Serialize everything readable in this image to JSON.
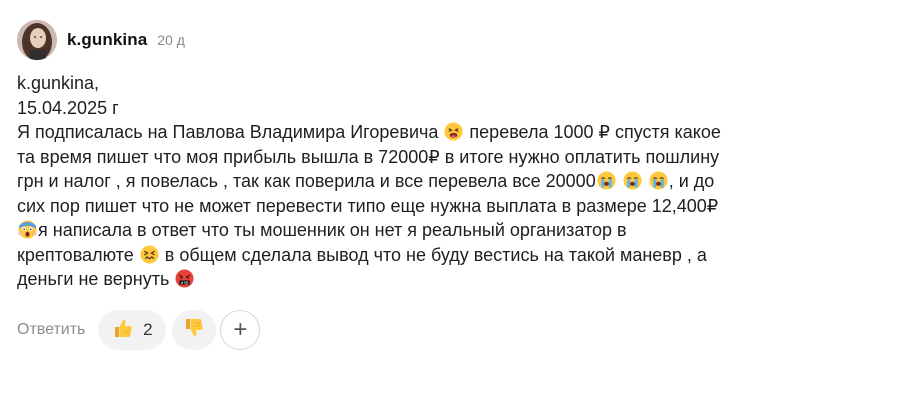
{
  "author": {
    "username": "k.gunkina",
    "time": "20 д"
  },
  "comment": {
    "lines": [
      "k.gunkina,",
      "15.04.2025 г",
      "Я подписалась на Павлова Владимира Игоревича",
      "перевела 1000 ₽ спустя какое",
      "та время пишет что моя прибыль вышла в 72000₽ в итоге нужно оплатить пошлину",
      "грн и налог , я повелась , так как поверила и все перевела все 20000",
      ", и до",
      "сих пор пишет что не может перевести типо еще нужна выплата в размере 12,400₽",
      "я написала в ответ что ты мошенник он нет я реальный организатор в",
      "крептовалюте",
      "в общем сделала вывод что не буду вестись на такой маневр , а",
      "деньги не вернуть"
    ]
  },
  "actions": {
    "reply_label": "Ответить",
    "like_count": "2",
    "add_reaction": "+"
  },
  "icons": {
    "like": "thumbs-up-icon",
    "dislike": "thumbs-down-icon",
    "add": "plus-icon"
  },
  "colors": {
    "emoji_yellow": "#FFC83D",
    "pill_bg": "#f2f2f2",
    "muted_text": "#8c8c8c"
  }
}
